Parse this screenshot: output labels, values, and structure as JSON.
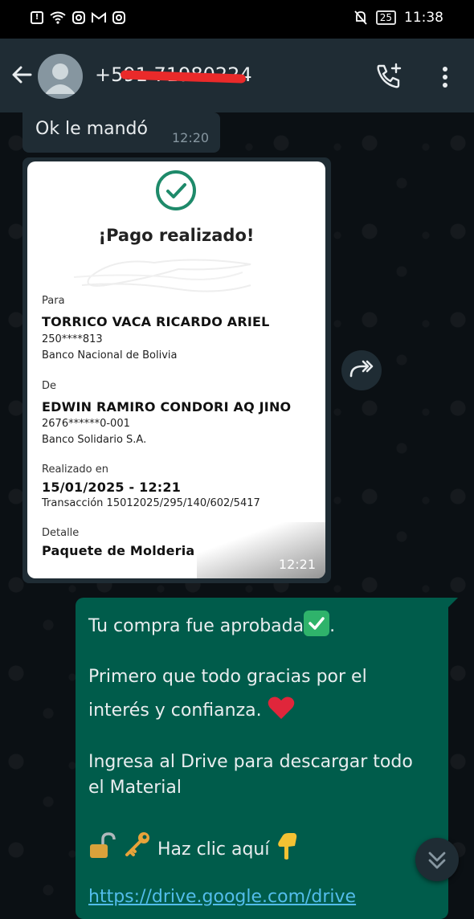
{
  "status_bar": {
    "time": "11:38",
    "battery": "25",
    "icons": [
      "alert-icon",
      "wifi-icon",
      "instagram-icon",
      "gmail-icon",
      "instagram-icon",
      "mute-icon"
    ]
  },
  "header": {
    "contact_name": "+591 71980224",
    "icons": [
      "back-arrow-icon",
      "avatar-icon",
      "add-call-icon",
      "more-vert-icon"
    ]
  },
  "messages": {
    "incoming_text": {
      "text": "Ok le mandó",
      "time": "12:20"
    },
    "image": {
      "time": "12:21",
      "receipt": {
        "title": "¡Pago realizado!",
        "para_label": "Para",
        "para_name": "TORRICO VACA RICARDO ARIEL",
        "para_account": "250****813",
        "para_bank": "Banco Nacional de Bolivia",
        "de_label": "De",
        "de_name": "EDWIN RAMIRO CONDORI AQ JINO",
        "de_account": "2676******0-001",
        "de_bank": "Banco Solidario S.A.",
        "realizado_label": "Realizado en",
        "realizado_date": "15/01/2025 - 12:21",
        "transaccion": "Transacción 15012025/295/140/602/5417",
        "detalle_label": "Detalle",
        "detalle_value": "Paquete de Molderia"
      }
    },
    "outgoing": {
      "line1": "Tu compra fue aprobada",
      "line1_end": ".",
      "line2": "Primero que todo gracias por el",
      "line3": "interés y confianza.",
      "line4": "Ingresa al Drive para descargar todo",
      "line5": "el Material",
      "line6": "Haz clic aquí",
      "link": "https://drive.google.com/drive"
    }
  },
  "colors": {
    "app_bar": "#1f2c34",
    "outgoing_bubble": "#005c4b",
    "incoming_bubble": "#1f2c34",
    "link": "#53bdeb",
    "check_green": "#1e8a6a"
  }
}
